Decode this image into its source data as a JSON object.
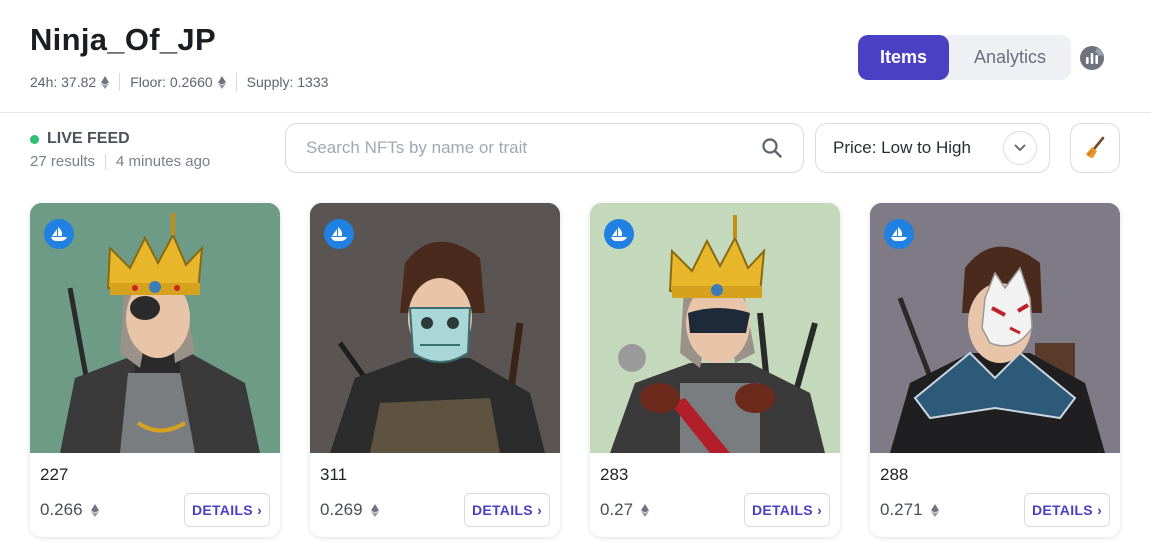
{
  "collection": {
    "title": "Ninja_Of_JP",
    "stats": {
      "volume_24h": "24h: 37.82",
      "floor": "Floor: 0.2660",
      "supply": "Supply: 1333"
    }
  },
  "view_toggle": {
    "items_label": "Items",
    "analytics_label": "Analytics",
    "active": "Items"
  },
  "feed": {
    "live_label": "LIVE FEED",
    "results": "27 results",
    "updated": "4 minutes ago"
  },
  "search": {
    "placeholder": "Search NFTs by name or trait",
    "value": ""
  },
  "sort": {
    "selected": "Price: Low to High"
  },
  "colors": {
    "accent": "#4b3fc3",
    "live_dot": "#2fbf71",
    "opensea_blue": "#2081e2"
  },
  "icons": [
    "eth-icon",
    "analytics-icon",
    "search-icon",
    "chevron-down-icon",
    "broom-icon",
    "opensea-icon"
  ],
  "cards": [
    {
      "name": "227",
      "price": "0.266",
      "details_label": "DETAILS ›",
      "bg": "#6e9b85"
    },
    {
      "name": "311",
      "price": "0.269",
      "details_label": "DETAILS ›",
      "bg": "#5a5452"
    },
    {
      "name": "283",
      "price": "0.27",
      "details_label": "DETAILS ›",
      "bg": "#c4d8bb"
    },
    {
      "name": "288",
      "price": "0.271",
      "details_label": "DETAILS ›",
      "bg": "#7e7a86"
    }
  ]
}
